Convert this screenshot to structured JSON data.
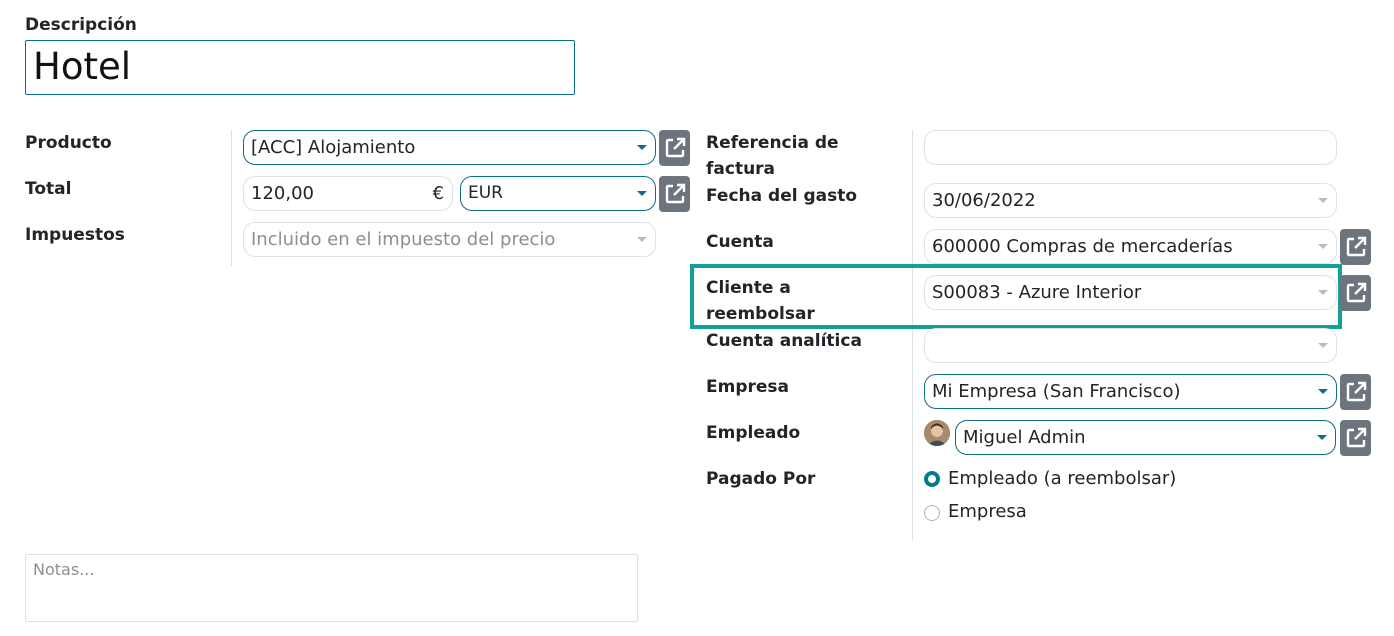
{
  "form": {
    "description_label": "Descripción",
    "description_value": "Hotel"
  },
  "left": {
    "product_label": "Producto",
    "product_value": "[ACC] Alojamiento",
    "total_label": "Total",
    "total_value": "120,00",
    "currency_symbol": "€",
    "currency_value": "EUR",
    "taxes_label": "Impuestos",
    "taxes_placeholder": "Incluido en el impuesto del precio"
  },
  "right": {
    "invoice_ref_label": "Referencia de factura",
    "invoice_ref_value": "",
    "date_label": "Fecha del gasto",
    "date_value": "30/06/2022",
    "account_label": "Cuenta",
    "account_value": "600000 Compras de mercaderías",
    "customer_label": "Cliente a reembolsar",
    "customer_value": "S00083 - Azure Interior",
    "analytic_label": "Cuenta analítica",
    "analytic_value": "",
    "company_label": "Empresa",
    "company_value": "Mi Empresa (San Francisco)",
    "employee_label": "Empleado",
    "employee_value": "Miguel Admin",
    "paid_by_label": "Pagado Por",
    "paid_by_options": [
      "Empleado (a reembolsar)",
      "Empresa"
    ],
    "paid_by_selected": "Empleado (a reembolsar)"
  },
  "notes": {
    "placeholder": "Notas..."
  },
  "colors": {
    "accent": "#017e84",
    "highlight": "#12a099",
    "button": "#6c757d"
  },
  "icons": {
    "external_link": "external-link-icon",
    "dropdown": "caret-down-icon",
    "avatar": "employee-avatar"
  }
}
